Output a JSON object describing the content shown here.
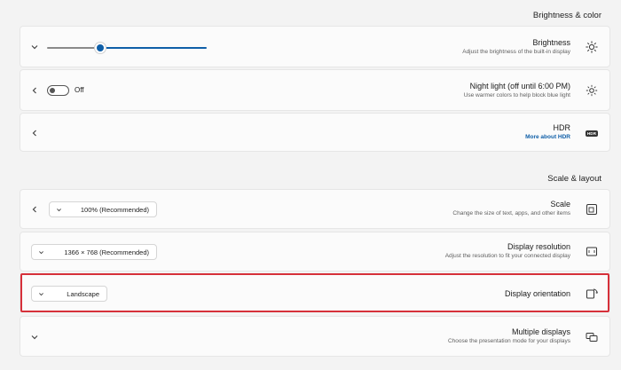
{
  "sections": {
    "brightness_color": "Brightness & color",
    "scale_layout": "Scale & layout"
  },
  "brightness": {
    "title": "Brightness",
    "subtitle": "Adjust the brightness of the built-in display",
    "level": 0.33
  },
  "night_light": {
    "title": "Night light (off until 6:00 PM)",
    "subtitle": "Use warmer colors to help block blue light",
    "state_label": "Off"
  },
  "hdr": {
    "title": "HDR",
    "link": "More about HDR",
    "icon_text": "HDR"
  },
  "scale": {
    "title": "Scale",
    "subtitle": "Change the size of text, apps, and other items",
    "value": "100% (Recommended)"
  },
  "resolution": {
    "title": "Display resolution",
    "subtitle": "Adjust the resolution to fit your connected display",
    "value": "1366 × 768 (Recommended)"
  },
  "orientation": {
    "title": "Display orientation",
    "value": "Landscape"
  },
  "multiple": {
    "title": "Multiple displays",
    "subtitle": "Choose the presentation mode for your displays"
  },
  "colors": {
    "accent": "#0f5fa8",
    "highlight": "#d6303a"
  }
}
